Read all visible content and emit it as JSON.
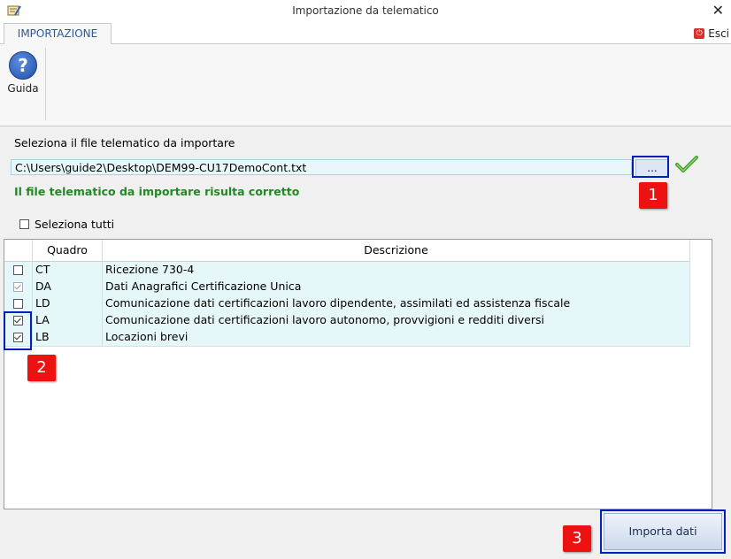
{
  "window": {
    "title": "Importazione da telematico"
  },
  "ribbon": {
    "tab": "IMPORTAZIONE",
    "exit_label": "Esci",
    "help_label": "Guida"
  },
  "file": {
    "label": "Seleziona il file telematico da importare",
    "path": "C:\\Users\\guide2\\Desktop\\DEM99-CU17DemoCont.txt",
    "browse_label": "...",
    "status": "Il file telematico da importare risulta corretto"
  },
  "select_all": {
    "label": "Seleziona tutti",
    "checked": false
  },
  "table": {
    "headers": [
      "",
      "Quadro",
      "Descrizione"
    ],
    "rows": [
      {
        "quadro": "CT",
        "descrizione": "Ricezione 730-4",
        "checked": false,
        "disabled": false
      },
      {
        "quadro": "DA",
        "descrizione": "Dati Anagrafici Certificazione Unica",
        "checked": true,
        "disabled": true
      },
      {
        "quadro": "LD",
        "descrizione": "Comunicazione dati certificazioni  lavoro dipendente, assimilati ed assistenza fiscale",
        "checked": false,
        "disabled": false
      },
      {
        "quadro": "LA",
        "descrizione": "Comunicazione dati certificazioni lavoro autonomo, provvigioni e redditi diversi",
        "checked": true,
        "disabled": false
      },
      {
        "quadro": "LB",
        "descrizione": "Locazioni brevi",
        "checked": true,
        "disabled": false
      }
    ]
  },
  "annotations": [
    "1",
    "2",
    "3"
  ],
  "actions": {
    "import_label": "Importa dati"
  },
  "colors": {
    "highlight": "#001fbd",
    "badge": "#ee1111",
    "ok_text": "#1f8a1f",
    "row_bg": "#e6f7fa"
  }
}
